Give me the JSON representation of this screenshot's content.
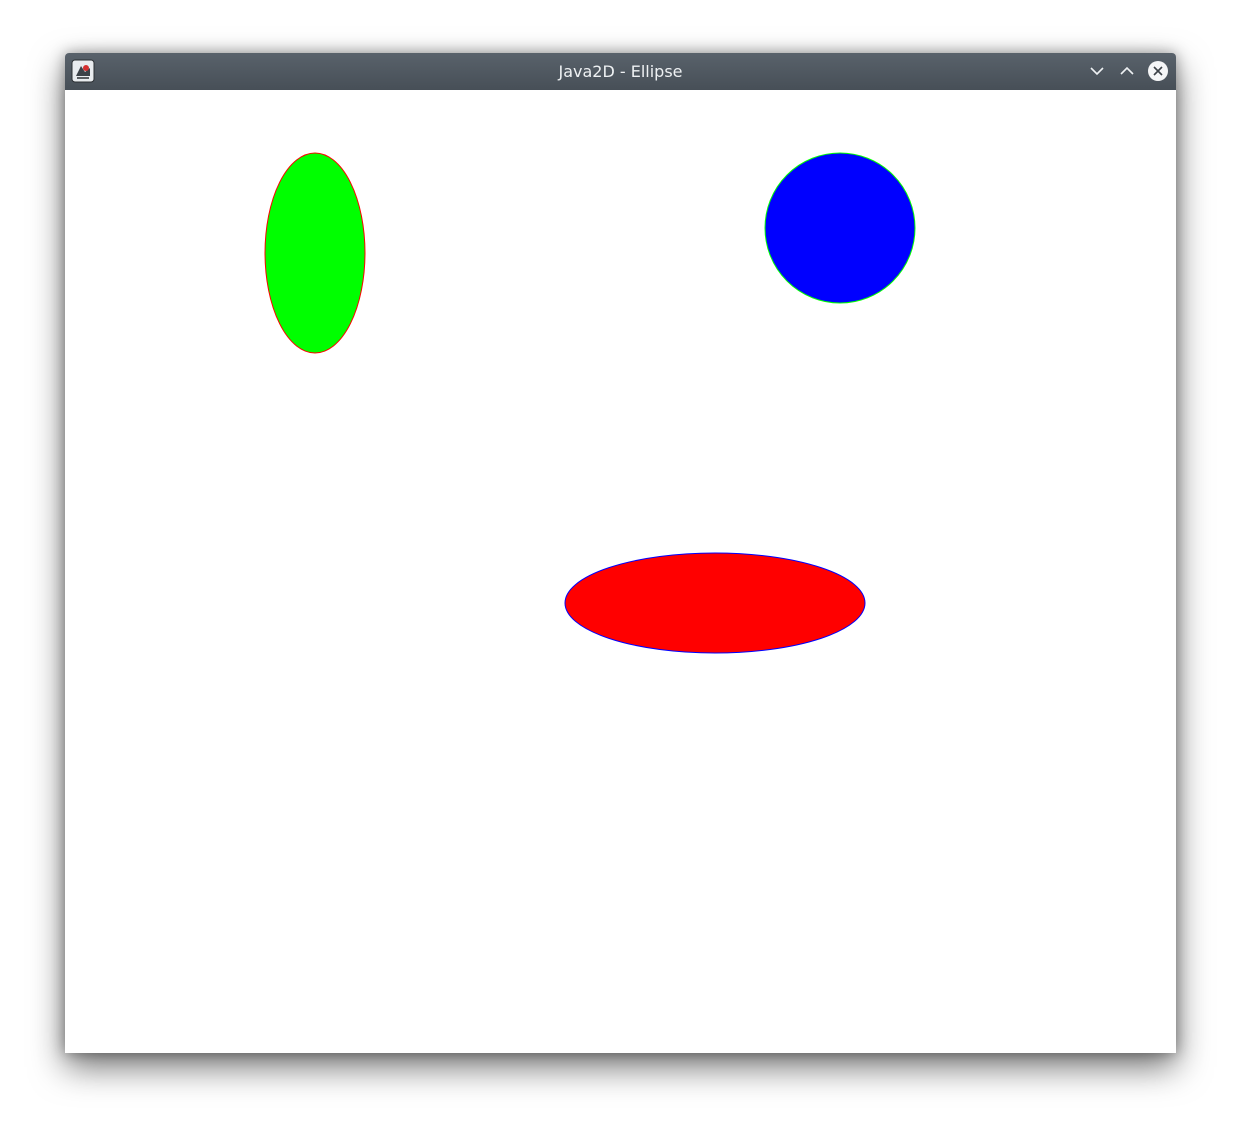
{
  "window": {
    "title": "Java2D - Ellipse",
    "icon": "java-app-icon",
    "controls": [
      "minimize-chevron-down-icon",
      "maximize-chevron-up-icon",
      "close-x-icon"
    ]
  },
  "canvas": {
    "background": "#ffffff",
    "shapes": [
      {
        "name": "green-ellipse",
        "fill": "#00ff00",
        "stroke": "#ff0000"
      },
      {
        "name": "blue-circle",
        "fill": "#0000ff",
        "stroke": "#00ff00"
      },
      {
        "name": "red-ellipse",
        "fill": "#ff0000",
        "stroke": "#0000ff"
      }
    ]
  }
}
